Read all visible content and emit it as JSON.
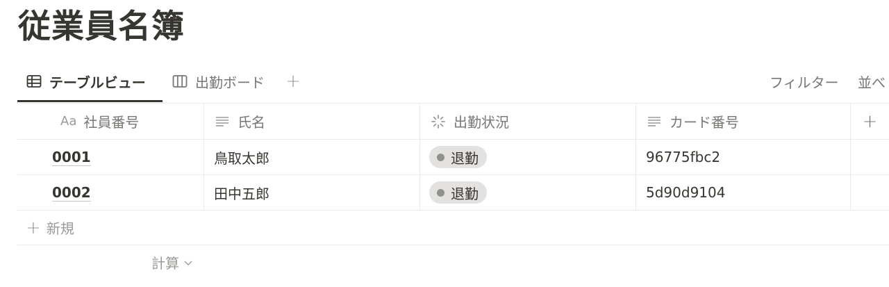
{
  "page": {
    "title": "従業員名簿"
  },
  "views": {
    "tabs": [
      {
        "label": "テーブルビュー",
        "icon": "table-icon",
        "active": true
      },
      {
        "label": "出勤ボード",
        "icon": "board-icon",
        "active": false
      }
    ],
    "add_view": "+",
    "toolbar": {
      "filter_label": "フィルター",
      "sort_label": "並べ"
    }
  },
  "table": {
    "columns": [
      {
        "label": "社員番号",
        "icon": "title-aa-icon",
        "icon_text": "Aa"
      },
      {
        "label": "氏名",
        "icon": "text-lines-icon"
      },
      {
        "label": "出勤状況",
        "icon": "status-loader-icon"
      },
      {
        "label": "カード番号",
        "icon": "text-lines-icon"
      }
    ],
    "add_column": "+",
    "rows": [
      {
        "id": "0001",
        "name": "鳥取太郎",
        "status": "退勤",
        "card": "96775fbc2"
      },
      {
        "id": "0002",
        "name": "田中五郎",
        "status": "退勤",
        "card": "5d90d9104"
      }
    ],
    "new_row_label": "新規",
    "new_row_plus": "+",
    "calc_label": "計算"
  },
  "colors": {
    "text": "#37352f",
    "muted": "#787774",
    "border": "#e9e9e7",
    "status_pill_bg": "#e3e2e0",
    "status_dot": "#91918e"
  }
}
